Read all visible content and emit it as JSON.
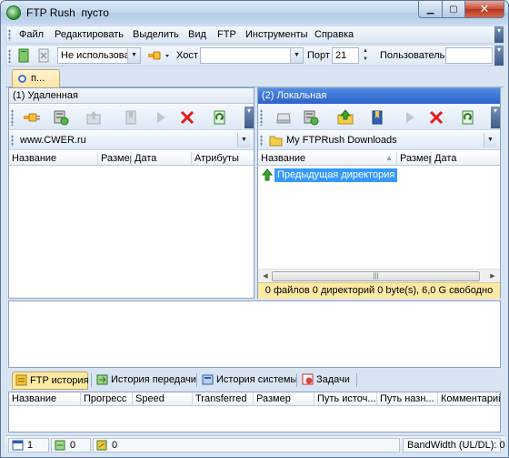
{
  "window": {
    "app_name": "FTP Rush",
    "document": "пусто"
  },
  "menu": [
    "Файл",
    "Редактировать",
    "Выделить",
    "Вид",
    "FTP",
    "Инструменты",
    "Справка"
  ],
  "toolbar": {
    "profile_value": "Не использовать",
    "host_label": "Хост",
    "host_value": "",
    "port_label": "Порт",
    "port_value": "21",
    "user_label": "Пользователь",
    "user_value": ""
  },
  "session_tab": {
    "label": "п..."
  },
  "remote": {
    "header": "(1) Удаленная",
    "address": "www.CWER.ru",
    "columns": [
      "Название",
      "Размер",
      "Дата",
      "Атрибуты"
    ],
    "icons": [
      "connect-icon",
      "site-manager-icon",
      "parent-folder-icon",
      "bookmark-icon",
      "play-icon",
      "stop-icon",
      "refresh-icon"
    ]
  },
  "local": {
    "header": "(2) Локальная",
    "address": "My FTPRush Downloads",
    "columns": [
      "Название",
      "Размер",
      "Дата"
    ],
    "sort_indicator": "▲",
    "rows": [
      "Предыдущая директория"
    ],
    "status": "0 файлов 0 директорий 0 byte(s), 6,0 G свободно",
    "icons": [
      "drive-icon",
      "site-manager-icon",
      "parent-folder-icon",
      "bookmark-icon",
      "play-icon",
      "stop-icon",
      "refresh-icon"
    ]
  },
  "bottom_tabs": [
    "FTP история",
    "История передачи",
    "История системы",
    "Задачи"
  ],
  "queue_columns": [
    "Название",
    "Прогресс",
    "Speed",
    "Transferred",
    "Размер",
    "Путь источ...",
    "Путь назн...",
    "Комментарий"
  ],
  "statusbar": {
    "count1": "1",
    "count2": "0",
    "count3": "0",
    "bandwidth": "BandWidth (UL/DL): 0"
  },
  "colors": {
    "active_header": "#2a62c9",
    "selection": "#3399ff",
    "status_strip": "#fbe9a4",
    "stop_red": "#e02020"
  }
}
